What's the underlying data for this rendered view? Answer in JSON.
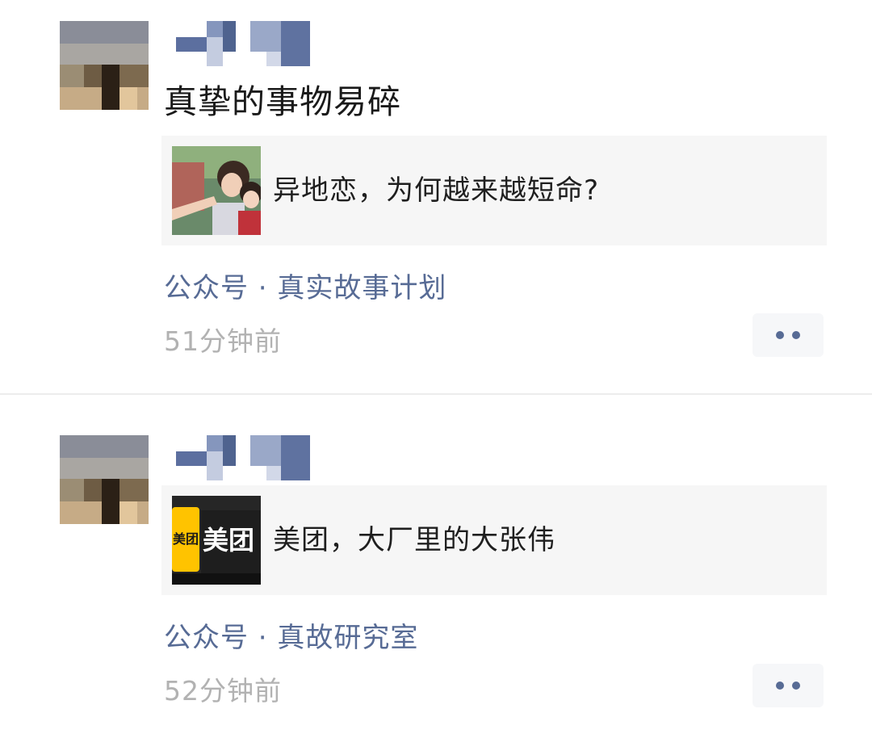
{
  "feed": {
    "posts": [
      {
        "text": "真挚的事物易碎",
        "card_title": "异地恋，为何越来越短命?",
        "source": "公众号 · 真实故事计划",
        "time": "51分钟前",
        "thumb_icon": "photo-couple-thumbnail"
      },
      {
        "text": "",
        "card_title": "美团，大厂里的大张伟",
        "source": "公众号 · 真故研究室",
        "time": "52分钟前",
        "thumb_icon": "meituan-sign-thumbnail",
        "thumb_logo_text": "美团"
      }
    ]
  },
  "colors": {
    "link": "#576b95",
    "time": "#b2b2b2",
    "card_bg": "#f6f6f6",
    "meituan_yellow": "#ffc300"
  },
  "icons": {
    "more": "more-dots-icon",
    "avatar": "blurred-avatar-icon",
    "name": "pixelated-username"
  }
}
